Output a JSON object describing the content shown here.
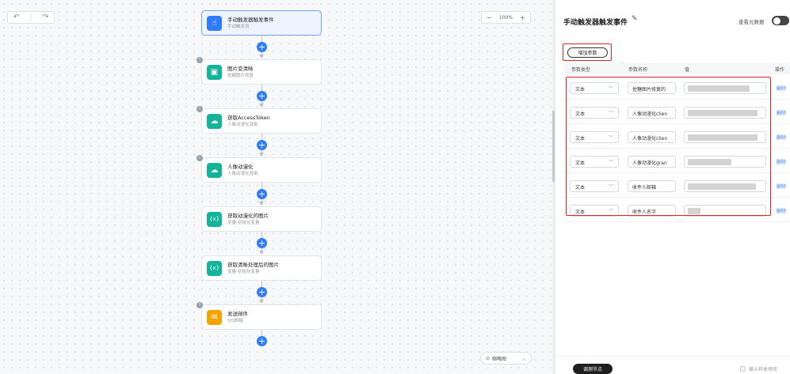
{
  "toolbar": {
    "undo_icon": "undo-icon",
    "redo_icon": "redo-icon",
    "separator": "|",
    "zoom_minus": "−",
    "zoom_value": "100%",
    "zoom_plus": "+"
  },
  "minimap": {
    "label": "缩略图"
  },
  "nodes": [
    {
      "title": "手动触发器触发事件",
      "subtitle": "手动触发流",
      "icon": "hand-pointer-icon",
      "color": "#2f7dff",
      "warning": false,
      "active": true
    },
    {
      "title": "图片变清晰",
      "subtitle": "佐糖图片修复",
      "icon": "image-enhance-icon",
      "color": "#13b49a",
      "warning": true,
      "active": false
    },
    {
      "title": "获取AccessToken",
      "subtitle": "人像动漫化混染",
      "icon": "cloud-icon",
      "color": "#13b49a",
      "warning": true,
      "active": false
    },
    {
      "title": "人像动漫化",
      "subtitle": "人像动漫化混染",
      "icon": "cloud-icon",
      "color": "#13b49a",
      "warning": true,
      "active": false
    },
    {
      "title": "获取动漫化的图片",
      "subtitle": "变量-初始化变量",
      "icon": "variable-icon",
      "color": "#13b49a",
      "warning": false,
      "active": false
    },
    {
      "title": "获取清晰处理后的图片",
      "subtitle": "变量-初始化变量",
      "icon": "variable-icon",
      "color": "#13b49a",
      "warning": false,
      "active": false
    },
    {
      "title": "发送邮件",
      "subtitle": "QQ邮箱",
      "icon": "mail-icon",
      "color": "#f5a300",
      "warning": true,
      "active": false
    }
  ],
  "panel": {
    "title": "手动触发器触发事件",
    "meta_label": "查看元数据",
    "add_param": "增加参数",
    "columns": {
      "type": "参数类型",
      "name": "参数名称",
      "value": "值",
      "action": "操作"
    },
    "rows": [
      {
        "type": "文本",
        "name": "佐糖图片修复的",
        "blur_width": 78
      },
      {
        "type": "文本",
        "name": "人像动漫化clien",
        "blur_width": 88
      },
      {
        "type": "文本",
        "name": "人像动漫化clien",
        "blur_width": 88
      },
      {
        "type": "文本",
        "name": "人像动漫化gran",
        "blur_width": 55
      },
      {
        "type": "文本",
        "name": "收件人邮箱",
        "blur_width": 86
      },
      {
        "type": "文本",
        "name": "收件人名字",
        "blur_width": 16
      }
    ],
    "delete_label": "删除",
    "debug_button": "调测节点",
    "sample_preview_label": "输入样本预览"
  }
}
